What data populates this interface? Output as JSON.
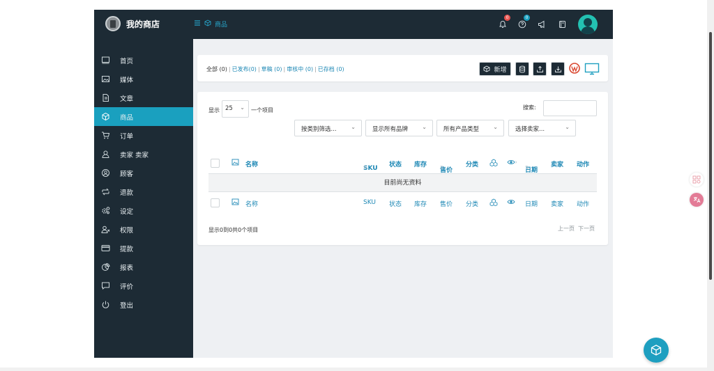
{
  "brand": {
    "name": "我的商店"
  },
  "breadcrumb": {
    "label": "商品"
  },
  "header": {
    "notifications_count": "0",
    "help_count": "0",
    "notifications_badge_color": "#e9534f",
    "help_badge_color": "#1aa0bf"
  },
  "sidebar": {
    "items": [
      {
        "label": "首页",
        "icon": "monitor-icon"
      },
      {
        "label": "媒体",
        "icon": "image-icon"
      },
      {
        "label": "文章",
        "icon": "document-icon"
      },
      {
        "label": "商品",
        "icon": "box-icon",
        "active": true
      },
      {
        "label": "订单",
        "icon": "cart-icon"
      },
      {
        "label": "卖家 卖家",
        "icon": "user-icon"
      },
      {
        "label": "顾客",
        "icon": "customer-icon"
      },
      {
        "label": "退款",
        "icon": "refund-icon"
      },
      {
        "label": "设定",
        "icon": "settings-icon"
      },
      {
        "label": "权限",
        "icon": "user-permission-icon"
      },
      {
        "label": "提款",
        "icon": "card-icon"
      },
      {
        "label": "报表",
        "icon": "pie-chart-icon"
      },
      {
        "label": "评价",
        "icon": "comment-icon"
      },
      {
        "label": "登出",
        "icon": "power-icon"
      }
    ]
  },
  "status_filters": {
    "all_label": "全部",
    "all_count": "(0)",
    "published": "已发布(0)",
    "draft": "草稿 (0)",
    "pending": "审核中 (0)",
    "archived": "已存档 (0)"
  },
  "toolbar": {
    "add_label": "新增"
  },
  "table_controls": {
    "show_label": "显示",
    "page_size": "25",
    "per_page_suffix": "一个项目",
    "search_label": "搜索:",
    "category_filter": "按类别筛选...",
    "brand_filter": "显示所有品牌",
    "type_filter": "所有产品类型",
    "seller_filter": "选择卖家..."
  },
  "table": {
    "columns": {
      "name": "名称",
      "sku": "SKU",
      "status": "状态",
      "stock": "库存",
      "price": "售价",
      "category": "分类",
      "date": "日期",
      "seller": "卖家",
      "action": "动作"
    },
    "empty_message": "目前尚无资料"
  },
  "footer": {
    "info": "显示0到0共0个项目",
    "prev": "上一页",
    "next": "下一页"
  },
  "colors": {
    "sidebar_bg": "#1d2b35",
    "accent": "#1aa0bf",
    "link": "#1e88b5"
  }
}
